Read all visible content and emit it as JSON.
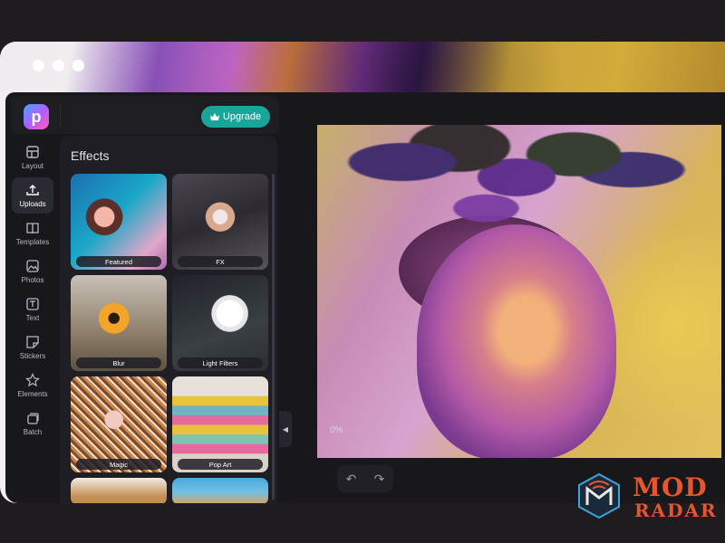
{
  "app": {
    "upgrade_label": "Upgrade"
  },
  "nav": {
    "items": [
      {
        "label": "Layout",
        "icon": "layout-icon"
      },
      {
        "label": "Uploads",
        "icon": "upload-icon",
        "active": true
      },
      {
        "label": "Templates",
        "icon": "book-icon"
      },
      {
        "label": "Photos",
        "icon": "image-icon"
      },
      {
        "label": "Text",
        "icon": "text-icon"
      },
      {
        "label": "Stickers",
        "icon": "sticker-icon"
      },
      {
        "label": "Elements",
        "icon": "star-icon"
      },
      {
        "label": "Batch",
        "icon": "batch-icon"
      }
    ]
  },
  "panel": {
    "title": "Effects",
    "tiles": [
      {
        "label": "Featured"
      },
      {
        "label": "FX"
      },
      {
        "label": "Blur"
      },
      {
        "label": "Light Filters"
      },
      {
        "label": "Magic"
      },
      {
        "label": "Pop Art"
      }
    ]
  },
  "zoom": {
    "value": "0%"
  },
  "brand": {
    "word1": "MOD",
    "word2": "RADAR"
  },
  "colors": {
    "accent": "#19a59a",
    "panel_bg": "#1e1e24",
    "app_bg": "#18181c",
    "brand": "#e4572e"
  }
}
